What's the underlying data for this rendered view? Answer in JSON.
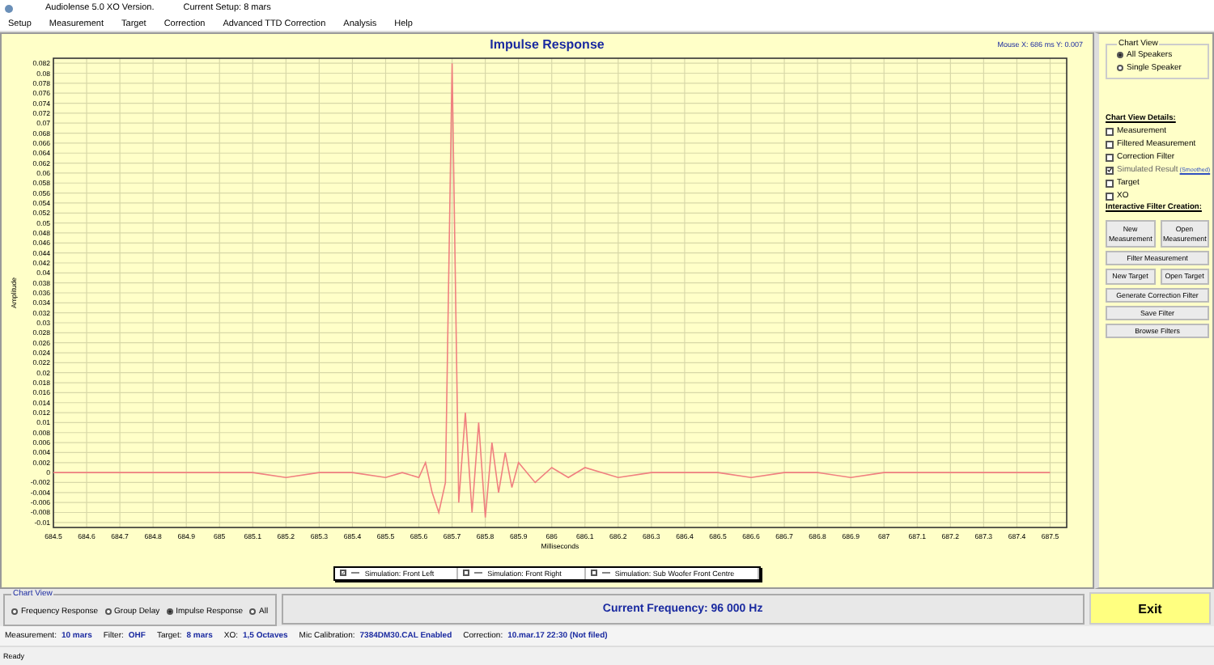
{
  "title_bar": {
    "app_title": "Audiolense 5.0 XO Version.",
    "setup": "Current Setup: 8 mars"
  },
  "menu": [
    "Setup",
    "Measurement",
    "Target",
    "Correction",
    "Advanced TTD Correction",
    "Analysis",
    "Help"
  ],
  "chart": {
    "title": "Impulse Response",
    "mouse_readout": "Mouse X: 686 ms  Y: 0.007",
    "chart_data": {
      "type": "line",
      "xlabel": "Milliseconds",
      "ylabel": "Amplitude",
      "x": [
        684.5,
        684.6,
        684.7,
        684.8,
        684.9,
        685,
        685.1,
        685.2,
        685.3,
        685.4,
        685.5,
        685.55,
        685.6,
        685.62,
        685.64,
        685.66,
        685.68,
        685.7,
        685.72,
        685.74,
        685.76,
        685.78,
        685.8,
        685.82,
        685.84,
        685.86,
        685.88,
        685.9,
        685.95,
        686,
        686.05,
        686.1,
        686.2,
        686.3,
        686.4,
        686.5,
        686.6,
        686.7,
        686.8,
        686.9,
        687,
        687.1,
        687.2,
        687.3,
        687.4,
        687.5
      ],
      "grid": true,
      "series": [
        {
          "color": "#f08080",
          "values": [
            0,
            0,
            0,
            0,
            0,
            0,
            0,
            -0.001,
            0,
            0,
            -0.001,
            0,
            -0.001,
            0.002,
            -0.004,
            -0.008,
            -0.002,
            0.082,
            -0.006,
            0.012,
            -0.008,
            0.01,
            -0.009,
            0.006,
            -0.004,
            0.004,
            -0.003,
            0.002,
            -0.002,
            0.001,
            -0.001,
            0.001,
            -0.001,
            0,
            0,
            0,
            -0.001,
            0,
            0,
            -0.001,
            0,
            0,
            0,
            0,
            0,
            0
          ]
        }
      ],
      "xlim": [
        684.5,
        687.55
      ],
      "ylim": [
        -0.011,
        0.083
      ],
      "xticks": [
        684.5,
        684.6,
        684.7,
        684.8,
        684.9,
        685,
        685.1,
        685.2,
        685.3,
        685.4,
        685.5,
        685.6,
        685.7,
        685.8,
        685.9,
        686,
        686.1,
        686.2,
        686.3,
        686.4,
        686.5,
        686.6,
        686.7,
        686.8,
        686.9,
        687,
        687.1,
        687.2,
        687.3,
        687.4,
        687.5
      ],
      "yticks": [
        0.082,
        0.08,
        0.078,
        0.076,
        0.074,
        0.072,
        0.07,
        0.068,
        0.066,
        0.064,
        0.062,
        0.06,
        0.058,
        0.056,
        0.054,
        0.052,
        0.05,
        0.048,
        0.046,
        0.044,
        0.042,
        0.04,
        0.038,
        0.036,
        0.034,
        0.032,
        0.03,
        0.028,
        0.026,
        0.024,
        0.022,
        0.02,
        0.018,
        0.016,
        0.014,
        0.012,
        0.01,
        0.008,
        0.006,
        0.004,
        0.002,
        0,
        -0.002,
        -0.004,
        -0.006,
        -0.008,
        -0.01
      ]
    }
  },
  "legend": [
    {
      "label": "Simulation: Front Left",
      "checked": true
    },
    {
      "label": "Simulation: Front Right",
      "checked": false
    },
    {
      "label": "Simulation: Sub Woofer Front Centre",
      "checked": false
    }
  ],
  "side_panel": {
    "view_group": {
      "title": "Chart View",
      "options": [
        {
          "label": "All Speakers",
          "selected": true
        },
        {
          "label": "Single Speaker",
          "selected": false
        }
      ]
    },
    "details_title": "Chart View Details:",
    "details": [
      {
        "label": "Measurement",
        "checked": false
      },
      {
        "label": "Filtered Measurement",
        "checked": false
      },
      {
        "label": "Correction Filter",
        "checked": false
      },
      {
        "label": "Simulated Result",
        "checked": true,
        "link": "(Smoothed)"
      },
      {
        "label": "Target",
        "checked": false
      },
      {
        "label": "XO",
        "checked": false
      }
    ],
    "filter_title": "Interactive Filter Creation:",
    "buttons": [
      [
        "New Measurement",
        "Open Measurement"
      ],
      [
        "Filter Measurement"
      ],
      [
        "New Target",
        "Open Target"
      ],
      [
        "Generate Correction Filter"
      ],
      [
        "Save Filter"
      ],
      [
        "Browse Filters"
      ]
    ]
  },
  "chart_view": {
    "title": "Chart View",
    "options": [
      {
        "label": "Frequency Response",
        "selected": false
      },
      {
        "label": "Group Delay",
        "selected": false
      },
      {
        "label": "Impulse Response",
        "selected": true
      },
      {
        "label": "All",
        "selected": false
      }
    ]
  },
  "current_frequency": "Current Frequency: 96 000 Hz",
  "exit_button": "Exit",
  "info": [
    {
      "label": "Measurement:",
      "value": "10 mars"
    },
    {
      "label": "Filter:",
      "value": "OHF"
    },
    {
      "label": "Target:",
      "value": "8 mars"
    },
    {
      "label": "XO:",
      "value": "1,5 Octaves"
    },
    {
      "label": "Mic Calibration:",
      "value": "7384DM30.CAL Enabled"
    },
    {
      "label": "Correction:",
      "value": "10.mar.17 22:30 (Not filed)"
    }
  ],
  "status": "Ready"
}
